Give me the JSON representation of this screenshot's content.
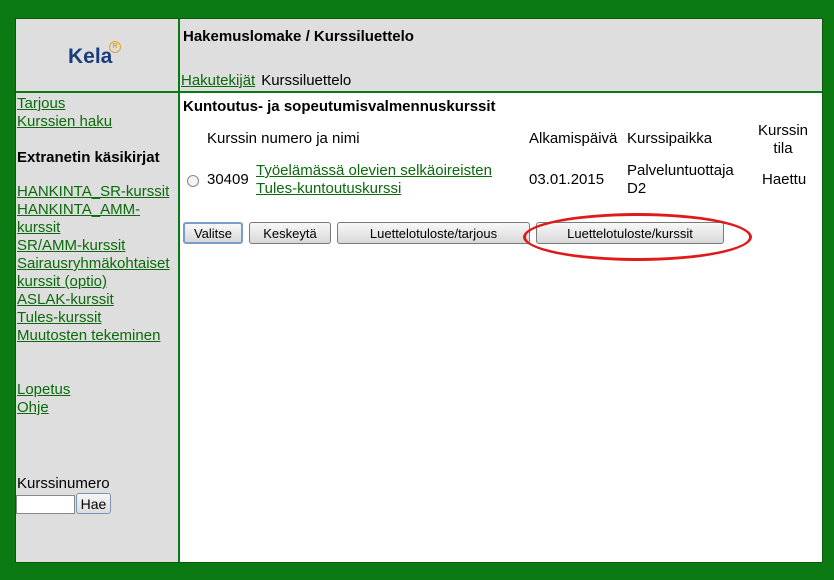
{
  "sidebar": {
    "logo": "Kela",
    "logo_mark": "R",
    "links_top": [
      "Tarjous",
      "Kurssien haku"
    ],
    "heading": "Extranetin käsikirjat",
    "links_manuals": [
      "HANKINTA_SR-kurssit",
      "HANKINTA_AMM-kurssit",
      "SR/AMM-kurssit",
      "Sairausryhmäkohtaiset kurssit (optio)",
      "ASLAK-kurssit",
      "Tules-kurssit",
      "Muutosten tekeminen"
    ],
    "links_bottom": [
      "Lopetus",
      "Ohje"
    ],
    "search_label": "Kurssinumero",
    "search_value": "",
    "search_button": "Hae"
  },
  "header": {
    "title": "Hakemuslomake / Kurssiluettelo",
    "breadcrumb_link": "Hakutekijät",
    "breadcrumb_current": "Kurssiluettelo"
  },
  "main": {
    "section_title": "Kuntoutus- ja sopeutumisvalmennuskurssit",
    "columns": {
      "name": "Kurssin numero ja nimi",
      "start": "Alkamispäivä",
      "place": "Kurssipaikka",
      "status": "Kurssin tila"
    },
    "row": {
      "number": "30409",
      "name": "Työelämässä olevien selkäoireisten Tules-kuntoutuskurssi",
      "start": "03.01.2015",
      "place": "Palveluntuottaja D2",
      "status": "Haettu"
    },
    "buttons": {
      "select": "Valitse",
      "cancel": "Keskeytä",
      "print_offer": "Luettelotuloste/tarjous",
      "print_courses": "Luettelotuloste/kurssit"
    }
  },
  "annotation_color": "#e01a1a"
}
